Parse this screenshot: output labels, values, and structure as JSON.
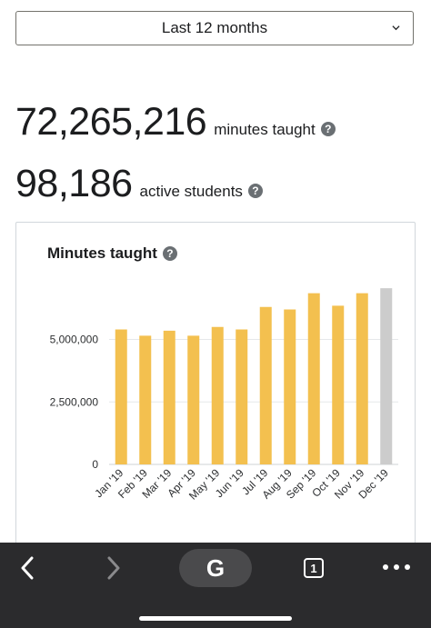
{
  "filter": {
    "selected": "Last 12 months"
  },
  "stats": [
    {
      "value": "72,265,216",
      "label": "minutes taught"
    },
    {
      "value": "98,186",
      "label": "active students"
    }
  ],
  "chart_card": {
    "title": "Minutes taught"
  },
  "chart_data": {
    "type": "bar",
    "title": "Minutes taught",
    "categories": [
      "Jan '19",
      "Feb '19",
      "Mar '19",
      "Apr '19",
      "May '19",
      "Jun '19",
      "Jul '19",
      "Aug '19",
      "Sep '19",
      "Oct '19",
      "Nov '19",
      "Dec '19"
    ],
    "values": [
      5400000,
      5150000,
      5350000,
      5150000,
      5500000,
      5400000,
      6300000,
      6200000,
      6850000,
      6350000,
      6850000,
      7050000
    ],
    "y_ticks": [
      0,
      2500000,
      5000000
    ],
    "y_tick_labels": [
      "0",
      "2,500,000",
      "5,000,000"
    ],
    "ylim": [
      0,
      7200000
    ],
    "bar_color": "#f3c04f",
    "partial_bar_color": "#cccccc",
    "partial_categories": [
      "Dec '19"
    ],
    "grid": true,
    "legend": "none"
  },
  "bottom_bar": {
    "background": "#2b2b2d",
    "back_icon": "chevron-left-icon",
    "forward_icon": "chevron-right-icon",
    "search_label": "G",
    "tab_count": "1",
    "more_icon": "more-horizontal-icon"
  }
}
